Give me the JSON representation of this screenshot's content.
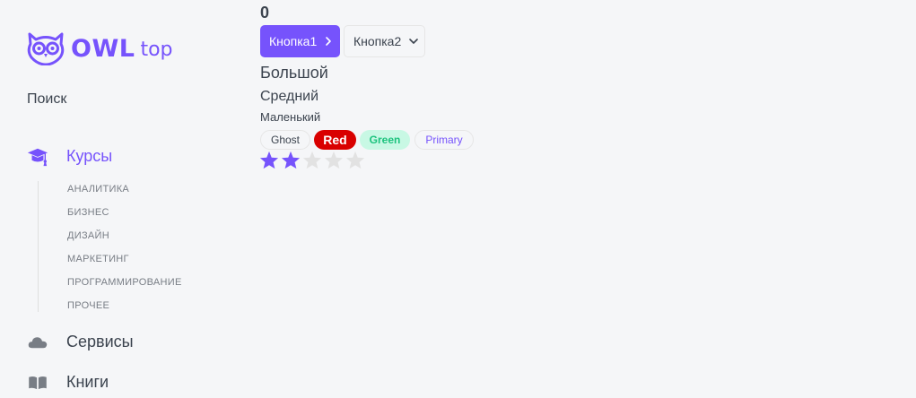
{
  "logo": {
    "owl": "OWL",
    "top": "top"
  },
  "sidebar": {
    "search_label": "Поиск",
    "menu": [
      {
        "label": "Курсы",
        "icon": "graduation-cap-icon",
        "active": true
      },
      {
        "label": "Сервисы",
        "icon": "cloud-icon",
        "active": false
      },
      {
        "label": "Книги",
        "icon": "book-icon",
        "active": false
      }
    ],
    "submenu": [
      "АНАЛИТИКА",
      "БИЗНЕС",
      "ДИЗАЙН",
      "МАРКЕТИНГ",
      "ПРОГРАММИРОВАНИЕ",
      "ПРОЧЕЕ"
    ]
  },
  "main": {
    "counter": "0",
    "button1": {
      "label": "Кнопка1",
      "icon": "chevron-right-icon"
    },
    "button2": {
      "label": "Кнопка2",
      "icon": "chevron-down-icon"
    },
    "heading_large": "Большой",
    "heading_medium": "Средний",
    "heading_small": "Маленький",
    "tags": {
      "ghost": "Ghost",
      "red": "Red",
      "green": "Green",
      "primary": "Primary"
    },
    "rating": {
      "value": 2,
      "max": 5
    }
  },
  "colors": {
    "accent": "#7653fc",
    "text": "#3b434e",
    "red": "#d90000",
    "green_bg": "#c8f8e4",
    "green_text": "#1dc37e",
    "star_empty": "#e2e2e2",
    "background": "#f5f6f8"
  }
}
